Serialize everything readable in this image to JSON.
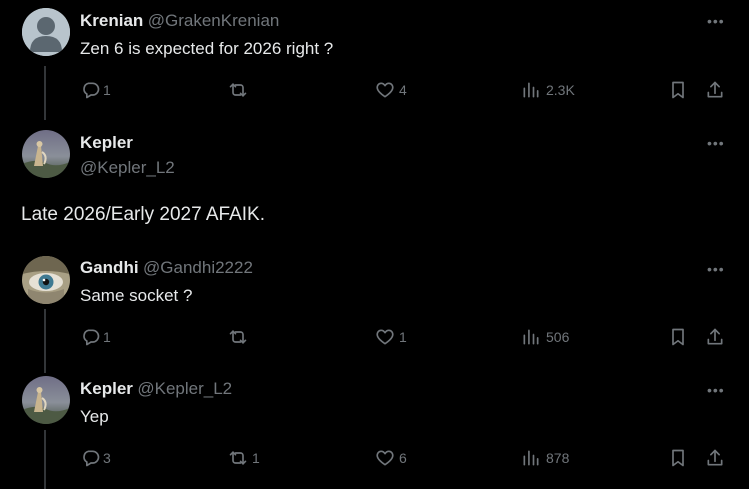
{
  "posts": [
    {
      "name": "Krenian",
      "handle": "@GrakenKrenian",
      "text": "Zen 6 is expected for 2026 right ?",
      "replies": "1",
      "reposts": "",
      "likes": "4",
      "views": "2.3K"
    },
    {
      "name": "Kepler",
      "handle": "@Kepler_L2",
      "text": "Late 2026/Early 2027 AFAIK."
    },
    {
      "name": "Gandhi",
      "handle": "@Gandhi2222",
      "text": "Same socket ?",
      "replies": "1",
      "reposts": "",
      "likes": "1",
      "views": "506"
    },
    {
      "name": "Kepler",
      "handle": "@Kepler_L2",
      "text": "Yep",
      "replies": "3",
      "reposts": "1",
      "likes": "6",
      "views": "878"
    }
  ],
  "more_glyph": "•••",
  "icons": [
    "more-icon",
    "reply-icon",
    "repost-icon",
    "like-icon",
    "views-icon",
    "bookmark-icon",
    "share-icon"
  ]
}
